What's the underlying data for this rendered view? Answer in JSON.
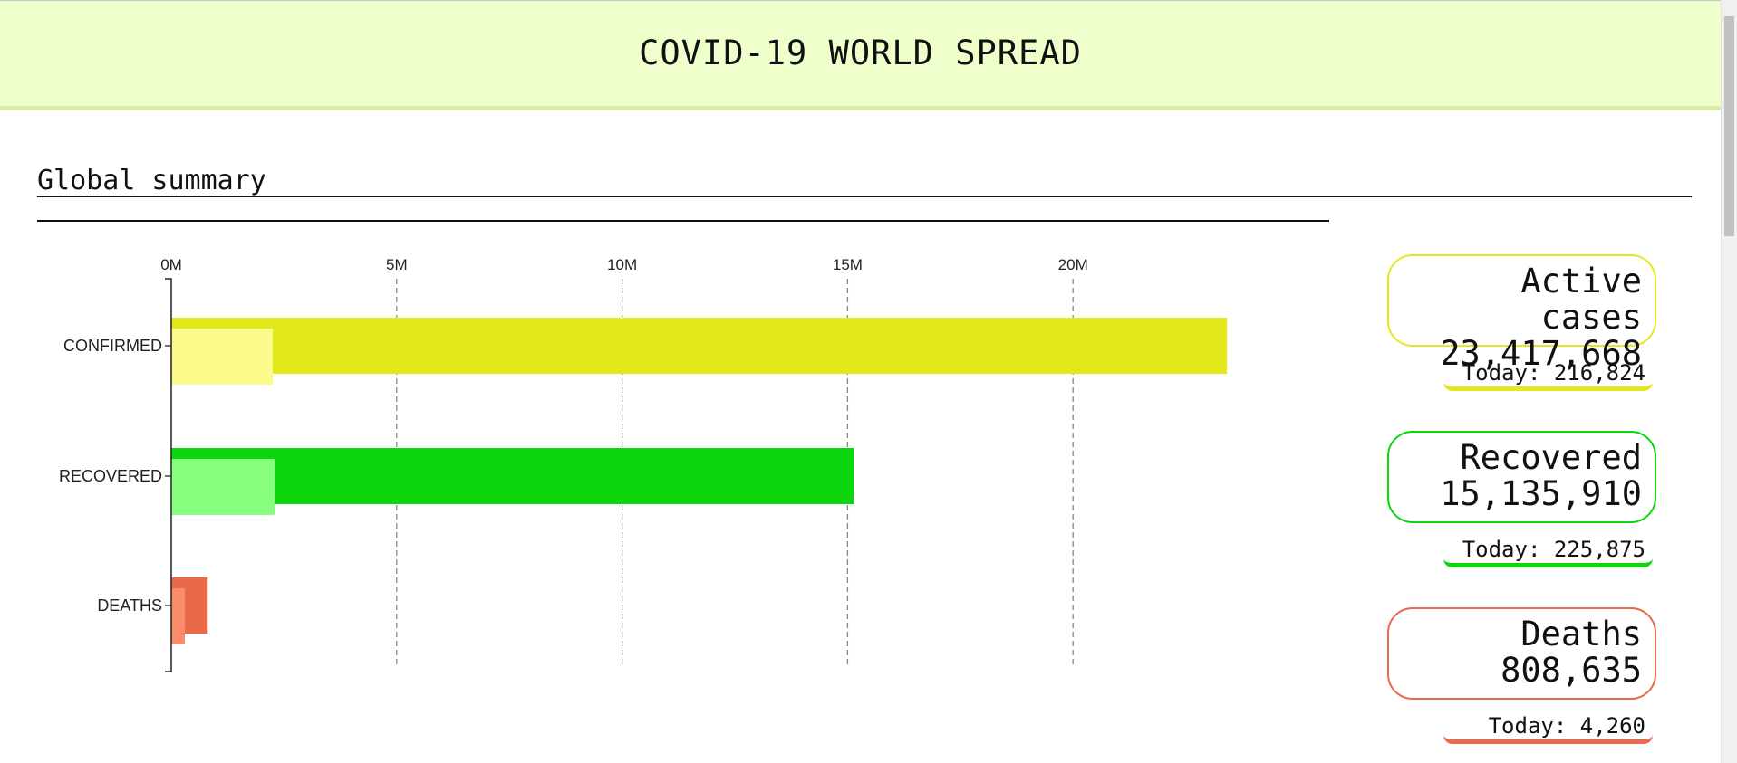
{
  "header": {
    "title": "COVID-19 WORLD SPREAD"
  },
  "section": {
    "title": "Global summary"
  },
  "colors": {
    "header_bg": "#eeffcc",
    "confirmed_total": "#e3e81d",
    "confirmed_today": "#fafb8a",
    "recovered_total": "#0cd60c",
    "recovered_today": "#88fe7f",
    "deaths_total": "#e9694b",
    "deaths_today": "#fa8b6c"
  },
  "chart_data": {
    "type": "bar",
    "orientation": "horizontal",
    "categories": [
      "CONFIRMED",
      "RECOVERED",
      "DEATHS"
    ],
    "x_ticks": [
      "0M",
      "5M",
      "10M",
      "15M",
      "20M"
    ],
    "x_tick_values": [
      0,
      5000000,
      10000000,
      15000000,
      20000000
    ],
    "xlim": [
      0,
      25000000
    ],
    "grid": true,
    "series": [
      {
        "values": [
          23417668,
          15135910,
          808635
        ]
      },
      {
        "values": [
          2250000,
          2300000,
          300000
        ]
      }
    ]
  },
  "cards": [
    {
      "label": "Active cases",
      "value": "23,417,668",
      "today": "Today: 216,824",
      "color": "#e3e81d"
    },
    {
      "label": "Recovered",
      "value": "15,135,910",
      "today": "Today: 225,875",
      "color": "#0cd60c"
    },
    {
      "label": "Deaths",
      "value": "808,635",
      "today": "Today: 4,260",
      "color": "#e9694b"
    }
  ]
}
